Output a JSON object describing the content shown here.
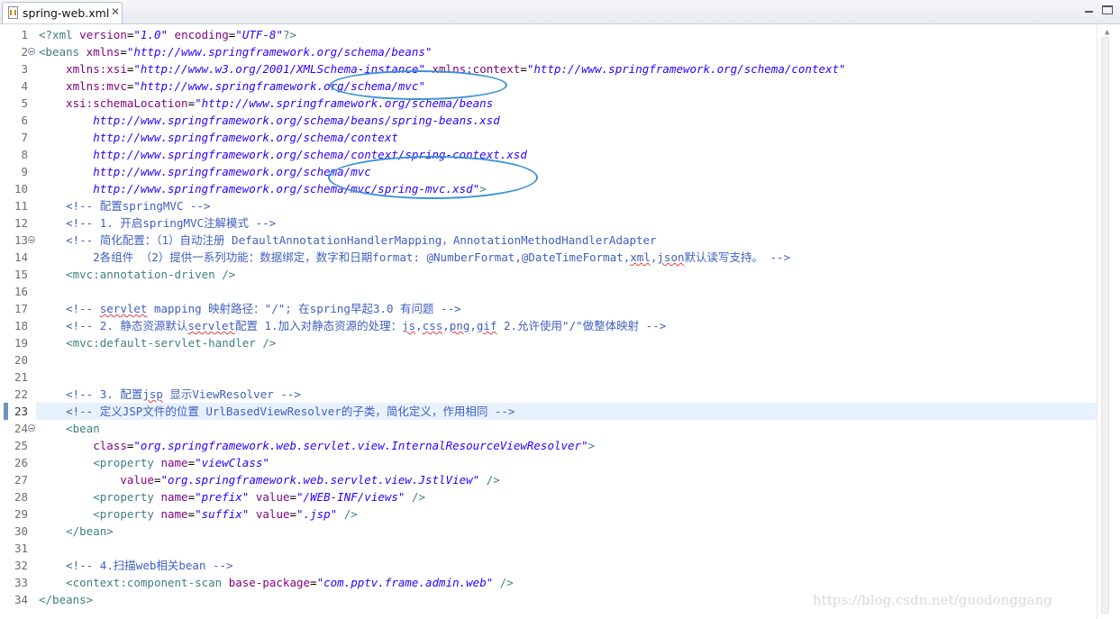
{
  "tab": {
    "filename": "spring-web.xml"
  },
  "editor": {
    "line_numbers": [
      "1",
      "2",
      "3",
      "4",
      "5",
      "6",
      "7",
      "8",
      "9",
      "10",
      "11",
      "12",
      "13",
      "14",
      "15",
      "16",
      "17",
      "18",
      "19",
      "20",
      "21",
      "22",
      "23",
      "24",
      "25",
      "26",
      "27",
      "28",
      "29",
      "30",
      "31",
      "32",
      "33",
      "34"
    ],
    "current_line": "23",
    "fold_lines": [
      "2",
      "13",
      "24"
    ],
    "lines": [
      [
        [
          "pi",
          "<?xml"
        ],
        [
          "attr",
          " version"
        ],
        [
          "t",
          "="
        ],
        [
          "str",
          "\"1.0\""
        ],
        [
          "attr",
          " encoding"
        ],
        [
          "t",
          "="
        ],
        [
          "str",
          "\"UTF-8\""
        ],
        [
          "pi",
          "?>"
        ]
      ],
      [
        [
          "tag",
          "<beans"
        ],
        [
          "attr",
          " xmlns"
        ],
        [
          "t",
          "="
        ],
        [
          "str",
          "\"http://www.springframework.org/schema/beans\""
        ]
      ],
      [
        [
          "t",
          "    "
        ],
        [
          "attr",
          "xmlns:xsi"
        ],
        [
          "t",
          "="
        ],
        [
          "str",
          "\"http://www.w3.org/2001/XMLSchema-instance\""
        ],
        [
          "attr",
          " xmlns:context"
        ],
        [
          "t",
          "="
        ],
        [
          "str",
          "\"http://www.springframework.org/schema/context\""
        ]
      ],
      [
        [
          "t",
          "    "
        ],
        [
          "attr",
          "xmlns:mvc"
        ],
        [
          "t",
          "="
        ],
        [
          "str",
          "\"http://www.springframework.org/schema/mvc\""
        ]
      ],
      [
        [
          "t",
          "    "
        ],
        [
          "attr",
          "xsi:schemaLocation"
        ],
        [
          "t",
          "="
        ],
        [
          "str",
          "\"http://www.springframework.org/schema/beans"
        ]
      ],
      [
        [
          "t",
          "        "
        ],
        [
          "str",
          "http://www.springframework.org/schema/beans/spring-beans.xsd"
        ]
      ],
      [
        [
          "t",
          "        "
        ],
        [
          "str",
          "http://www.springframework.org/schema/context"
        ]
      ],
      [
        [
          "t",
          "        "
        ],
        [
          "str",
          "http://www.springframework.org/schema/context/spring-context.xsd"
        ]
      ],
      [
        [
          "t",
          "        "
        ],
        [
          "str",
          "http://www.springframework.org/schema/mvc"
        ]
      ],
      [
        [
          "t",
          "        "
        ],
        [
          "str",
          "http://www.springframework.org/schema/mvc/spring-mvc.xsd\""
        ],
        [
          "tag",
          ">"
        ]
      ],
      [
        [
          "t",
          "    "
        ],
        [
          "cmt",
          "<!-- 配置springMVC -->"
        ]
      ],
      [
        [
          "t",
          "    "
        ],
        [
          "cmt",
          "<!-- 1. 开启springMVC注解模式 -->"
        ]
      ],
      [
        [
          "t",
          "    "
        ],
        [
          "cmt",
          "<!-- 简化配置：（1）自动注册 DefaultAnnotationHandlerMapping，AnnotationMethodHandlerAdapter"
        ]
      ],
      [
        [
          "t",
          "        "
        ],
        [
          "cmt",
          "2各组件 （2）提供一系列功能：数据绑定，数字和日期format: @NumberFormat,@DateTimeFormat,"
        ],
        [
          "cmtsq",
          "xml"
        ],
        [
          "cmt",
          ","
        ],
        [
          "cmtsq",
          "json"
        ],
        [
          "cmt",
          "默认读写支持。 -->"
        ]
      ],
      [
        [
          "t",
          "    "
        ],
        [
          "tag",
          "<mvc:annotation-driven />"
        ]
      ],
      [],
      [
        [
          "t",
          "    "
        ],
        [
          "cmt",
          "<!-- "
        ],
        [
          "cmtsq",
          "servlet"
        ],
        [
          "cmt",
          " mapping 映射路径：\"/\"; 在spring早起3.0 有问题 -->"
        ]
      ],
      [
        [
          "t",
          "    "
        ],
        [
          "cmt",
          "<!-- 2. 静态资源默认"
        ],
        [
          "cmtsq",
          "servlet"
        ],
        [
          "cmt",
          "配置 1.加入对静态资源的处理："
        ],
        [
          "cmtsq",
          "js"
        ],
        [
          "cmt",
          ","
        ],
        [
          "cmtsq",
          "css"
        ],
        [
          "cmt",
          ","
        ],
        [
          "cmtsq",
          "png"
        ],
        [
          "cmt",
          ","
        ],
        [
          "cmtsq",
          "gif"
        ],
        [
          "cmt",
          " 2.允许使用\"/\"做整体映射 -->"
        ]
      ],
      [
        [
          "t",
          "    "
        ],
        [
          "tag",
          "<mvc:default-servlet-handler />"
        ]
      ],
      [],
      [],
      [
        [
          "t",
          "    "
        ],
        [
          "cmt",
          "<!-- 3. 配置"
        ],
        [
          "cmtsq",
          "jsp"
        ],
        [
          "cmt",
          " 显示ViewResolver -->"
        ]
      ],
      [
        [
          "t",
          "    "
        ],
        [
          "cmt",
          "<!-- 定义JSP文件的位置 UrlBasedViewResolver的子类，简化定义，作用相同 -->"
        ]
      ],
      [
        [
          "t",
          "    "
        ],
        [
          "tag",
          "<bean"
        ]
      ],
      [
        [
          "t",
          "        "
        ],
        [
          "attr",
          "class"
        ],
        [
          "t",
          "="
        ],
        [
          "str",
          "\"org.springframework.web.servlet.view.InternalResourceViewResolver\""
        ],
        [
          "tag",
          ">"
        ]
      ],
      [
        [
          "t",
          "        "
        ],
        [
          "tag",
          "<property"
        ],
        [
          "attr",
          " name"
        ],
        [
          "t",
          "="
        ],
        [
          "str",
          "\"viewClass\""
        ]
      ],
      [
        [
          "t",
          "            "
        ],
        [
          "attr",
          "value"
        ],
        [
          "t",
          "="
        ],
        [
          "str",
          "\"org.springframework.web.servlet.view.JstlView\""
        ],
        [
          "tag",
          " />"
        ]
      ],
      [
        [
          "t",
          "        "
        ],
        [
          "tag",
          "<property"
        ],
        [
          "attr",
          " name"
        ],
        [
          "t",
          "="
        ],
        [
          "str",
          "\"prefix\""
        ],
        [
          "attr",
          " value"
        ],
        [
          "t",
          "="
        ],
        [
          "str",
          "\"/WEB-INF/views\""
        ],
        [
          "tag",
          " />"
        ]
      ],
      [
        [
          "t",
          "        "
        ],
        [
          "tag",
          "<property"
        ],
        [
          "attr",
          " name"
        ],
        [
          "t",
          "="
        ],
        [
          "str",
          "\"suffix\""
        ],
        [
          "attr",
          " value"
        ],
        [
          "t",
          "="
        ],
        [
          "str",
          "\".jsp\""
        ],
        [
          "tag",
          " />"
        ]
      ],
      [
        [
          "t",
          "    "
        ],
        [
          "tag",
          "</bean>"
        ]
      ],
      [],
      [
        [
          "t",
          "    "
        ],
        [
          "cmt",
          "<!-- 4.扫描web相关bean -->"
        ]
      ],
      [
        [
          "t",
          "    "
        ],
        [
          "tag",
          "<context:component-scan"
        ],
        [
          "attr",
          " base-package"
        ],
        [
          "t",
          "="
        ],
        [
          "str",
          "\"com.pptv.frame.admin.web\""
        ],
        [
          "tag",
          " />"
        ]
      ],
      [
        [
          "tag",
          "</beans>"
        ]
      ]
    ]
  },
  "watermark": "https://blog.csdn.net/guodonggang"
}
